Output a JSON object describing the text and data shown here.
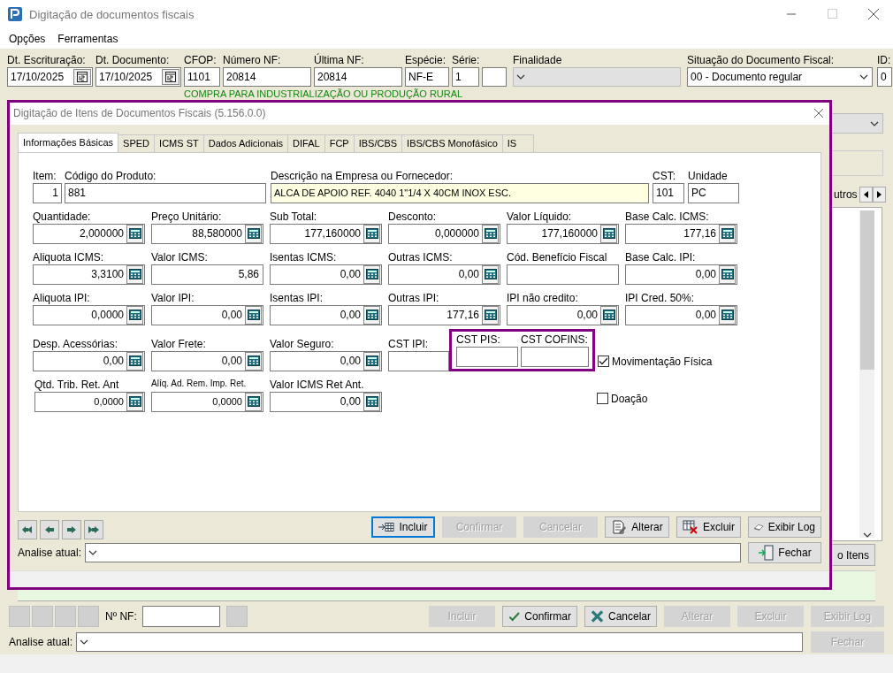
{
  "window": {
    "title": "Digitação de documentos fiscais"
  },
  "menu": [
    "Opções",
    "Ferramentas"
  ],
  "header_fields": [
    {
      "label": "Dt. Escrituração:",
      "value": "17/10/2025",
      "kind": "date"
    },
    {
      "label": "Dt. Documento:",
      "value": "17/10/2025",
      "kind": "date"
    },
    {
      "label": "CFOP:",
      "value": "1101",
      "kind": "text"
    },
    {
      "label": "Número NF:",
      "value": "20814",
      "kind": "text"
    },
    {
      "label": "Última NF:",
      "value": "20814",
      "kind": "text"
    },
    {
      "label": "Espécie:",
      "value": "NF-E",
      "kind": "text"
    },
    {
      "label": "Série:",
      "value": "1",
      "kind": "text"
    },
    {
      "kind": "text"
    },
    {
      "label": "Finalidade",
      "kind": "select",
      "disabled": true
    },
    {
      "label": "Situação do Documento Fiscal:",
      "value": "00 - Documento regular",
      "kind": "select",
      "disabled": false
    },
    {
      "label": "ID:",
      "value": "0",
      "kind": "text"
    }
  ],
  "cfop_description": "COMPRA PARA INDUSTRIALIZAÇÃO OU PRODUÇÃO RURAL",
  "background": {
    "tab_fragment": "utros",
    "button_fragment": "o Itens"
  },
  "dialog": {
    "title": "Digitação de Itens de Documentos Fiscais (5.156.0.0)",
    "highlighted": true,
    "tabs": [
      {
        "label": "Informações Básicas",
        "selected": true
      },
      {
        "label": "SPED",
        "selected": false
      },
      {
        "label": "ICMS ST",
        "selected": false
      },
      {
        "label": "Dados Adicionais",
        "selected": false
      },
      {
        "label": "DIFAL",
        "selected": false
      },
      {
        "label": "FCP",
        "selected": false
      },
      {
        "label": "IBS/CBS",
        "selected": false
      },
      {
        "label": "IBS/CBS Monofásico",
        "selected": false
      },
      {
        "label": "IS",
        "selected": false
      }
    ],
    "rows": [
      {
        "fields": [
          {
            "label": "Item:",
            "value": "1",
            "kind": "item"
          },
          {
            "label": "Código do Produto:",
            "value": "881",
            "kind": "code"
          },
          {
            "label": "Descrição na Empresa ou Fornecedor:",
            "value": "ALCA DE APOIO REF. 4040 1\"1/4 X 40CM INOX ESC.",
            "kind": "description"
          },
          {
            "label": "CST:",
            "value": "101",
            "kind": "cst"
          },
          {
            "label": "Unidade",
            "value": "PC",
            "kind": "unit"
          }
        ]
      },
      {
        "fields": [
          {
            "label": "Quantidade:",
            "value": "2,000000",
            "kind": "calc"
          },
          {
            "label": "Preço Unitário:",
            "value": "88,580000",
            "kind": "calc"
          },
          {
            "label": "Sub Total:",
            "value": "177,160000",
            "kind": "calc"
          },
          {
            "label": "Desconto:",
            "value": "0,000000",
            "kind": "calc"
          },
          {
            "label": "Valor Líquido:",
            "value": "177,160000",
            "kind": "calc"
          },
          {
            "label": "Base Calc. ICMS:",
            "value": "177,16",
            "kind": "calc"
          }
        ]
      },
      {
        "fields": [
          {
            "label": "Aliquota ICMS:",
            "value": "3,3100",
            "kind": "calc"
          },
          {
            "label": "Valor ICMS:",
            "value": "5,86",
            "kind": "number"
          },
          {
            "label": "Isentas ICMS:",
            "value": "0,00",
            "kind": "calc"
          },
          {
            "label": "Outras ICMS:",
            "value": "0,00",
            "kind": "calc"
          },
          {
            "label": "Cód. Benefício Fiscal",
            "kind": "number"
          },
          {
            "label": "Base Calc. IPI:",
            "value": "0,00",
            "kind": "calc"
          }
        ]
      },
      {
        "fields": [
          {
            "label": "Aliquota IPI:",
            "value": "0,0000",
            "kind": "calc"
          },
          {
            "label": "Valor IPI:",
            "value": "0,00",
            "kind": "calc"
          },
          {
            "label": "Isentas IPI:",
            "value": "0,00",
            "kind": "calc"
          },
          {
            "label": "Outras IPI:",
            "value": "177,16",
            "kind": "calc"
          },
          {
            "label": "IPI não credito:",
            "value": "0,00",
            "kind": "calc"
          },
          {
            "label": "IPI Cred. 50%:",
            "value": "0,00",
            "kind": "calc"
          }
        ]
      },
      {
        "fields": [
          {
            "label": "Desp. Acessórias:",
            "value": "0,00",
            "kind": "calc"
          },
          {
            "label": "Valor Frete:",
            "value": "0,00",
            "kind": "calc"
          },
          {
            "label": "Valor Seguro:",
            "value": "0,00",
            "kind": "calc"
          },
          {
            "label": "CST IPI:",
            "kind": "cst-ipi"
          }
        ],
        "group": {
          "highlighted": true,
          "fields": [
            {
              "label": "CST PIS:"
            },
            {
              "label": "CST COFINS:"
            }
          ]
        },
        "checkbox": {
          "label": "Movimentação Física",
          "checked": true
        }
      },
      {
        "fields": [
          {
            "label": "Qtd. Trib. Ret. Ant",
            "value": "0,0000",
            "kind": "calc-small"
          },
          {
            "label": "Alíq. Ad. Rem. Imp. Ret.",
            "value": "0,0000",
            "kind": "calc-small"
          },
          {
            "label": "Valor ICMS Ret Ant.",
            "value": "0,00",
            "kind": "calc"
          }
        ],
        "checkbox": {
          "label": "Doação",
          "checked": false
        }
      }
    ],
    "buttons": [
      {
        "label": "Incluir",
        "kind": "add",
        "disabled": false,
        "focused": true
      },
      {
        "label": "Confirmar",
        "disabled": true,
        "focused": false
      },
      {
        "label": "Cancelar",
        "disabled": true,
        "focused": false
      },
      {
        "label": "Alterar",
        "kind": "edit",
        "disabled": false,
        "focused": false
      },
      {
        "label": "Excluir",
        "kind": "delete",
        "disabled": false,
        "focused": false
      },
      {
        "label": "Exibir Log",
        "kind": "log",
        "disabled": false,
        "focused": false
      }
    ],
    "analise_label": "Analise atual:",
    "close_button": {
      "label": "Fechar",
      "kind": "exit",
      "disabled": false,
      "focused": false
    }
  },
  "footer": {
    "nf_label": "Nº NF:",
    "buttons": [
      {
        "label": "Incluir",
        "disabled": true,
        "focused": false
      },
      {
        "label": "Confirmar",
        "kind": "check",
        "disabled": false,
        "focused": false
      },
      {
        "label": "Cancelar",
        "kind": "cancel",
        "disabled": false,
        "focused": false
      },
      {
        "label": "Alterar",
        "disabled": true,
        "focused": false
      },
      {
        "label": "Excluir",
        "disabled": true,
        "focused": false
      },
      {
        "label": "Exibir Log",
        "disabled": true,
        "focused": false
      }
    ],
    "analise_label": "Analise atual:",
    "close_button": {
      "label": "Fechar",
      "disabled": true,
      "focused": false
    }
  }
}
